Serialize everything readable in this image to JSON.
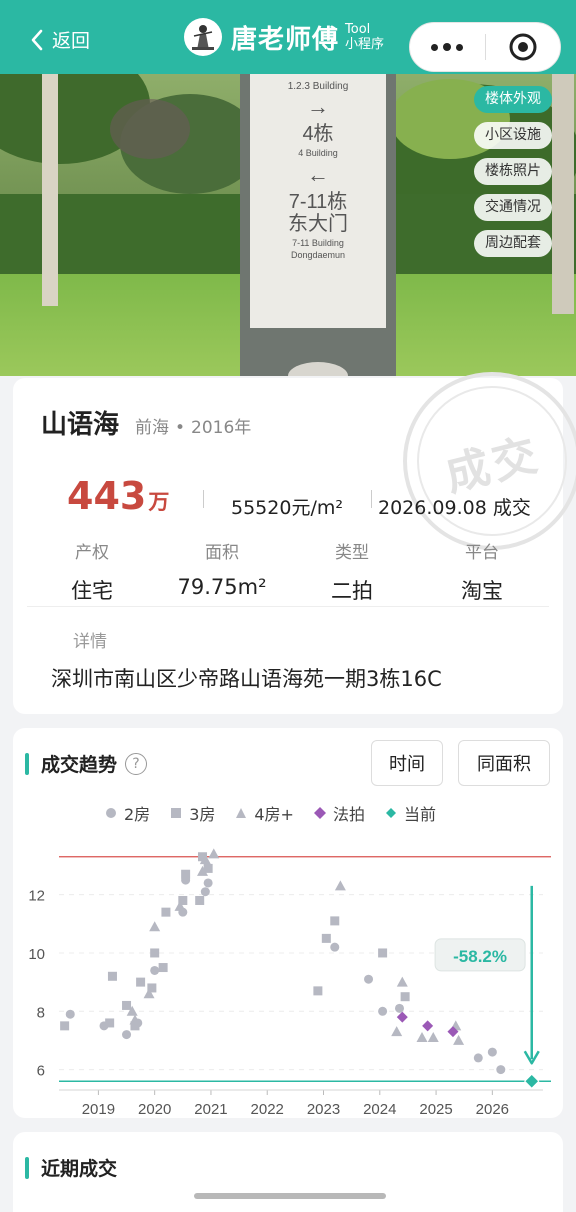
{
  "header": {
    "back_label": "返回",
    "brand_name": "唐老师傅",
    "brand_tag": "Tool",
    "brand_sub": "小程序",
    "bg_color": "#2bb8a3"
  },
  "hero": {
    "sign_lines": [
      "1.2.3 Building",
      "4栋",
      "4 Building",
      "7-11栋",
      "东大门",
      "7-11 Building",
      "Dongdaemun"
    ],
    "tags": [
      "楼体外观",
      "小区设施",
      "楼栋照片",
      "交通情况",
      "周边配套"
    ],
    "active_tag": "楼体外观"
  },
  "listing": {
    "name": "山语海",
    "district": "前海",
    "year": "2016年",
    "stamp": "成交",
    "price_value": "443",
    "price_unit": "万",
    "unit_price": "55520元/m²",
    "deal_text": "2026.09.08 成交",
    "fields": [
      {
        "label": "产权",
        "value": "住宅"
      },
      {
        "label": "面积",
        "value": "79.75m²"
      },
      {
        "label": "类型",
        "value": "二拍"
      },
      {
        "label": "平台",
        "value": "淘宝"
      }
    ],
    "detail_label": "详情",
    "address": "深圳市南山区少帝路山语海苑一期3栋16C"
  },
  "trend": {
    "title": "成交趋势",
    "help_icon": "?",
    "btn_time": "时间",
    "btn_same_area": "同面积",
    "legend": [
      {
        "label": "2房",
        "shape": "circle",
        "color": "#b6b8c2"
      },
      {
        "label": "3房",
        "shape": "square",
        "color": "#b6b8c2"
      },
      {
        "label": "4房+",
        "shape": "triangle",
        "color": "#b6b8c2"
      },
      {
        "label": "法拍",
        "shape": "diamond",
        "color": "#9b59b6"
      },
      {
        "label": "当前",
        "shape": "diamond",
        "color": "#2bb8a3"
      }
    ]
  },
  "chart_data": {
    "type": "scatter",
    "xlabel": "",
    "ylabel": "",
    "x_ticks": [
      "2019",
      "2020",
      "2021",
      "2022",
      "2023",
      "2024",
      "2025",
      "2026"
    ],
    "y_ticks": [
      6,
      8,
      10,
      12
    ],
    "xlim": [
      2018.3,
      2026.9
    ],
    "ylim": [
      5.3,
      13.6
    ],
    "max_line": 13.3,
    "current_line": 5.6,
    "change_label": "-58.2%",
    "series": [
      {
        "name": "2房",
        "shape": "circle",
        "points": [
          [
            2018.5,
            7.9
          ],
          [
            2019.1,
            7.5
          ],
          [
            2019.5,
            7.2
          ],
          [
            2019.7,
            7.6
          ],
          [
            2020.0,
            9.4
          ],
          [
            2020.5,
            11.4
          ],
          [
            2020.55,
            12.5
          ],
          [
            2020.9,
            12.1
          ],
          [
            2020.95,
            12.4
          ],
          [
            2023.2,
            10.2
          ],
          [
            2023.8,
            9.1
          ],
          [
            2024.05,
            8.0
          ],
          [
            2024.35,
            8.1
          ],
          [
            2025.75,
            6.4
          ],
          [
            2026.0,
            6.6
          ],
          [
            2026.15,
            6.0
          ]
        ]
      },
      {
        "name": "3房",
        "shape": "square",
        "points": [
          [
            2018.4,
            7.5
          ],
          [
            2019.2,
            7.6
          ],
          [
            2019.25,
            9.2
          ],
          [
            2019.5,
            8.2
          ],
          [
            2019.65,
            7.5
          ],
          [
            2019.75,
            9.0
          ],
          [
            2019.95,
            8.8
          ],
          [
            2020.0,
            10.0
          ],
          [
            2020.15,
            9.5
          ],
          [
            2020.2,
            11.4
          ],
          [
            2020.5,
            11.8
          ],
          [
            2020.55,
            12.7
          ],
          [
            2020.8,
            11.8
          ],
          [
            2020.85,
            13.3
          ],
          [
            2020.95,
            12.9
          ],
          [
            2022.9,
            8.7
          ],
          [
            2023.05,
            10.5
          ],
          [
            2023.2,
            11.1
          ],
          [
            2024.05,
            10.0
          ],
          [
            2024.45,
            8.5
          ]
        ]
      },
      {
        "name": "4房+",
        "shape": "triangle",
        "points": [
          [
            2019.6,
            8.0
          ],
          [
            2019.65,
            7.7
          ],
          [
            2019.9,
            8.6
          ],
          [
            2020.0,
            10.9
          ],
          [
            2020.45,
            11.6
          ],
          [
            2020.85,
            12.8
          ],
          [
            2020.9,
            13.2
          ],
          [
            2021.05,
            13.4
          ],
          [
            2023.3,
            12.3
          ],
          [
            2024.3,
            7.3
          ],
          [
            2024.4,
            9.0
          ],
          [
            2024.75,
            7.1
          ],
          [
            2024.95,
            7.1
          ],
          [
            2025.35,
            7.5
          ],
          [
            2025.4,
            7.0
          ]
        ]
      },
      {
        "name": "法拍",
        "shape": "diamond",
        "points": [
          [
            2024.4,
            7.8
          ],
          [
            2024.85,
            7.5
          ],
          [
            2025.3,
            7.3
          ]
        ]
      },
      {
        "name": "当前",
        "shape": "diamond",
        "points": [
          [
            2026.7,
            5.6
          ]
        ]
      }
    ]
  },
  "recent": {
    "title": "近期成交"
  }
}
